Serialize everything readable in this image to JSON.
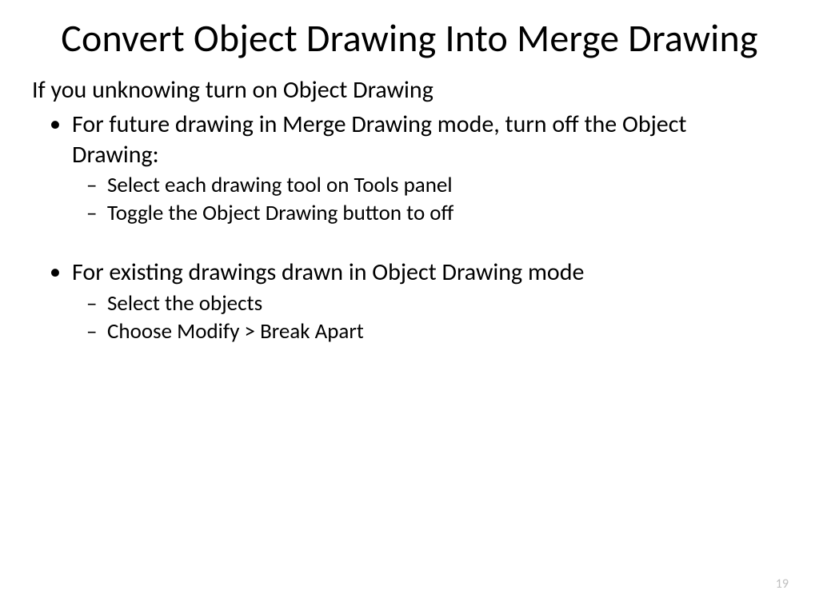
{
  "title": "Convert Object Drawing Into Merge Drawing",
  "intro": "If you unknowing turn on Object Drawing",
  "bullets": {
    "b1": {
      "text": "For future drawing in Merge Drawing mode, turn off the Object Drawing:",
      "sub": {
        "s1": "Select each drawing tool on Tools panel",
        "s2": "Toggle the Object Drawing button to off"
      }
    },
    "b2": {
      "text": "For existing drawings drawn in Object Drawing mode",
      "sub": {
        "s1": "Select the objects",
        "s2": "Choose Modify > Break Apart"
      }
    }
  },
  "page_number": "19"
}
